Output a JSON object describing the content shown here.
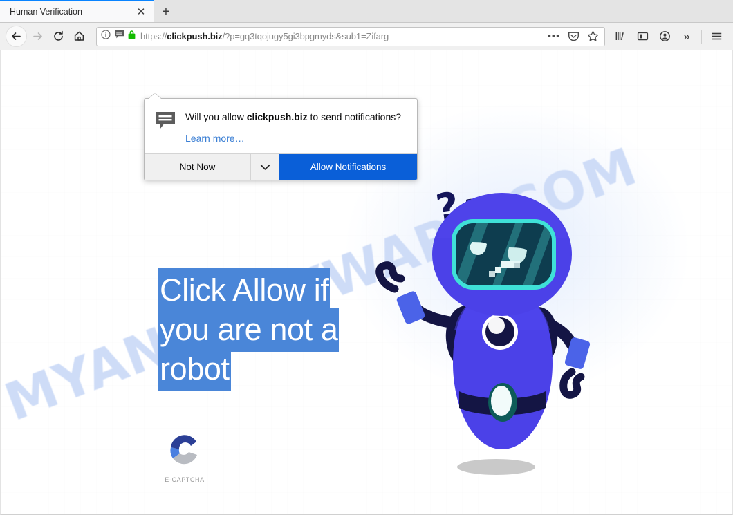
{
  "browser": {
    "tab": {
      "title": "Human Verification",
      "close_label": "✕",
      "new_tab_label": "+"
    },
    "nav": {
      "back_label": "Back",
      "forward_label": "Forward",
      "reload_label": "Reload",
      "home_label": "Home"
    },
    "urlbar": {
      "scheme": "https://",
      "host": "clickpush.biz",
      "path": "/?p=gq3tqojugy5gi3bpgmyds&sub1=Zifarg",
      "full_url": "https://clickpush.biz/?p=gq3tqojugy5gi3bpgmyds&sub1=Zifarg",
      "identity_icons": [
        "info-icon",
        "notification-permission-icon",
        "padlock-icon"
      ],
      "page_actions_label": "•••",
      "pocket_label": "Save to Pocket",
      "bookmark_label": "Bookmark this page"
    },
    "toolbar_right": {
      "library_label": "Library",
      "sidebar_label": "Sidebars",
      "account_label": "Account",
      "overflow_label": "»",
      "menu_label": "Open menu"
    }
  },
  "doorhanger": {
    "question_prefix": "Will you allow ",
    "question_host": "clickpush.biz",
    "question_suffix": " to send notifications?",
    "learn_more": "Learn more…",
    "not_now": "Not Now",
    "not_now_accesskey": "N",
    "dropmarker_icon": "chevron-down-icon",
    "allow": "Allow Notifications",
    "allow_accesskey": "A",
    "primary_color": "#0a5fd8"
  },
  "page": {
    "headline_lines": [
      "Click Allow if",
      "you are not a",
      "robot"
    ],
    "headline_full": "Click Allow if you are not a robot",
    "selection_color": "#4a86d8",
    "watermark": "MYANTISPYWARE.COM",
    "watermark_color": "#cedcf7",
    "captcha": {
      "label": "E-CAPTCHA",
      "logo_colors": [
        "#2b3f96",
        "#4a7fe0",
        "#b9bcc2"
      ]
    },
    "robot": {
      "alt": "confused blue robot illustration",
      "thought_marks": "??",
      "body_color": "#4b41e8",
      "head_color": "#4a3fe2",
      "visor_color": "#0e3d4f",
      "visor_border_color": "#3fe0d8",
      "dark_color": "#141544",
      "shadow_color": "#c9c9c9"
    }
  }
}
